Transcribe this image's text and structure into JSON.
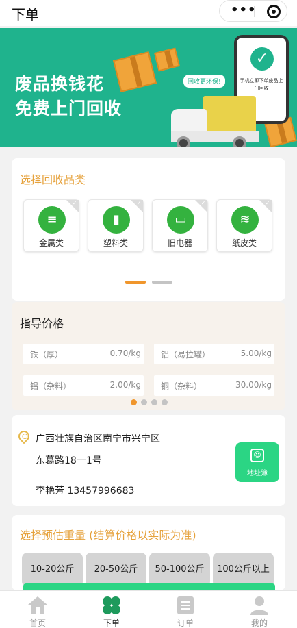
{
  "titlebar": {
    "title": "下单",
    "more_label": "•••"
  },
  "banner": {
    "headline_1": "废品换钱花",
    "headline_2": "免费上门回收",
    "bubble": "回收更环保!",
    "phone_text": "手机立即下单废品上门回收",
    "accent": "#1fb38d"
  },
  "category": {
    "title": "选择回收品类",
    "items": [
      {
        "label": "金属类",
        "icon": "screw-icon"
      },
      {
        "label": "塑料类",
        "icon": "bottle-icon"
      },
      {
        "label": "旧电器",
        "icon": "appliance-icon"
      },
      {
        "label": "纸皮类",
        "icon": "paper-stack-icon"
      }
    ],
    "icon_color": "#34b23f"
  },
  "price": {
    "title": "指导价格",
    "rows": [
      {
        "name": "铁（厚）",
        "value": "0.70/kg"
      },
      {
        "name": "铝（易拉罐）",
        "value": "5.00/kg"
      },
      {
        "name": "铝（杂料）",
        "value": "2.00/kg"
      },
      {
        "name": "铜（杂料）",
        "value": "30.00/kg"
      }
    ],
    "page_count": 4,
    "active_page": 1,
    "active_dot_color": "#f0962c"
  },
  "address": {
    "line1": "广西壮族自治区南宁市兴宁区",
    "line2": "东葛路18一1号",
    "contact": "李艳芳 13457996683",
    "book_label": "地址簿",
    "book_color": "#2bd584"
  },
  "weight": {
    "title": "选择预估重量 (结算价格以实际为准)",
    "options": [
      "10-20公斤",
      "20-50公斤",
      "50-100公斤",
      "100公斤以上"
    ]
  },
  "tabbar": {
    "items": [
      {
        "label": "首页",
        "icon": "home-icon"
      },
      {
        "label": "下单",
        "icon": "clover-icon"
      },
      {
        "label": "订单",
        "icon": "order-icon"
      },
      {
        "label": "我的",
        "icon": "user-icon"
      }
    ],
    "active_index": 1
  }
}
